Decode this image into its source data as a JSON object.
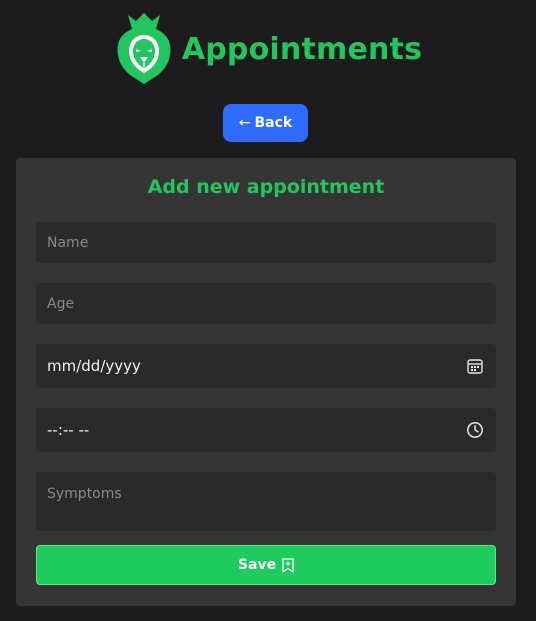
{
  "header": {
    "title": "Appointments",
    "logo_icon": "lion-crown-icon"
  },
  "back_button": {
    "label": "Back",
    "icon": "arrow-left-icon"
  },
  "form": {
    "title": "Add new appointment",
    "name_placeholder": "Name",
    "age_placeholder": "Age",
    "date_value": "mm/dd/yyyy",
    "date_icon": "calendar-icon",
    "time_value": "--:-- --",
    "time_icon": "clock-icon",
    "symptoms_placeholder": "Symptoms",
    "save_label": "Save",
    "save_icon": "bookmark-plus-icon"
  },
  "colors": {
    "page_background": "#1c1c1c",
    "card_background": "#353535",
    "input_background": "#2a2a2a",
    "accent_green": "#22c55e",
    "save_button": "#1ecc5e",
    "back_button": "#2f6bff",
    "text_light": "#f2f2f2",
    "placeholder": "#8a8a8a"
  }
}
